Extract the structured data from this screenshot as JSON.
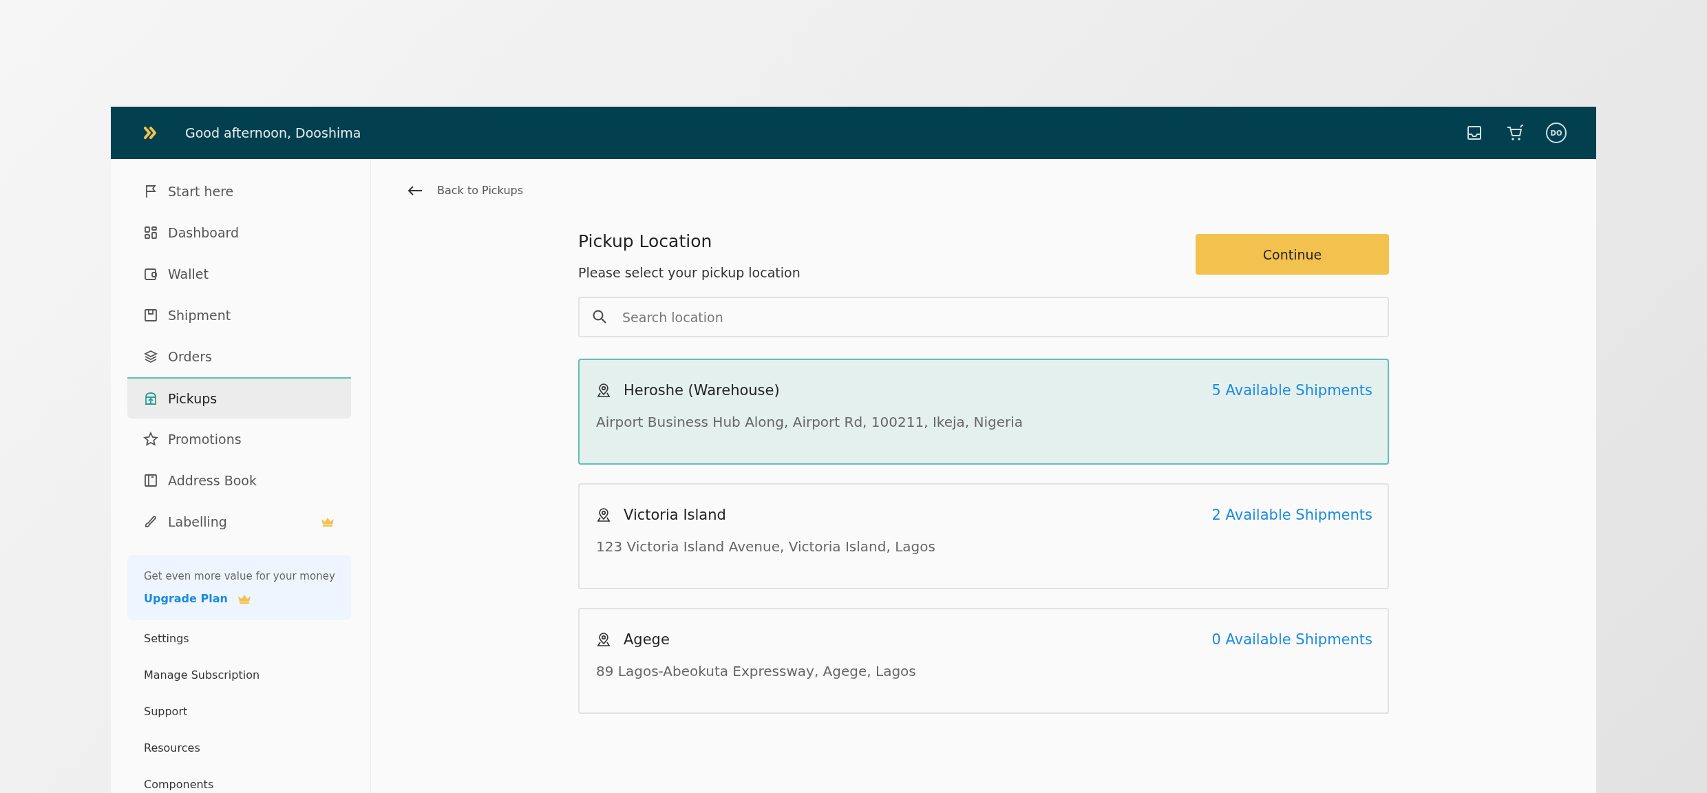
{
  "header": {
    "greeting": "Good afternoon, Dooshima",
    "avatar_initials": "DO"
  },
  "sidebar": {
    "items": [
      {
        "label": "Start here",
        "selected": false,
        "premium": false
      },
      {
        "label": "Dashboard",
        "selected": false,
        "premium": false
      },
      {
        "label": "Wallet",
        "selected": false,
        "premium": false
      },
      {
        "label": "Shipment",
        "selected": false,
        "premium": false
      },
      {
        "label": "Orders",
        "selected": false,
        "premium": false
      },
      {
        "label": "Pickups",
        "selected": true,
        "premium": false
      },
      {
        "label": "Promotions",
        "selected": false,
        "premium": false
      },
      {
        "label": "Address Book",
        "selected": false,
        "premium": false
      },
      {
        "label": "Labelling",
        "selected": false,
        "premium": true
      }
    ],
    "promo": {
      "text": "Get even more value for your money",
      "link": "Upgrade Plan"
    },
    "links": [
      "Settings",
      "Manage Subscription",
      "Support",
      "Resources",
      "Components"
    ]
  },
  "main": {
    "back_link": "Back to Pickups",
    "title": "Pickup Location",
    "subtitle": "Please select your pickup location",
    "continue_button": "Continue",
    "search": {
      "placeholder": "Search location"
    },
    "locations": [
      {
        "name": "Heroshe (Warehouse)",
        "address": "Airport Business Hub Along, Airport Rd, 100211, Ikeja, Nigeria",
        "shipments": "5 Available Shipments",
        "selected": true
      },
      {
        "name": "Victoria Island",
        "address": "123 Victoria Island Avenue, Victoria Island, Lagos",
        "shipments": "2 Available Shipments",
        "selected": false
      },
      {
        "name": "Agege",
        "address": "89 Lagos-Abeokuta Expressway, Agege, Lagos",
        "shipments": "0 Available Shipments",
        "selected": false
      }
    ]
  }
}
